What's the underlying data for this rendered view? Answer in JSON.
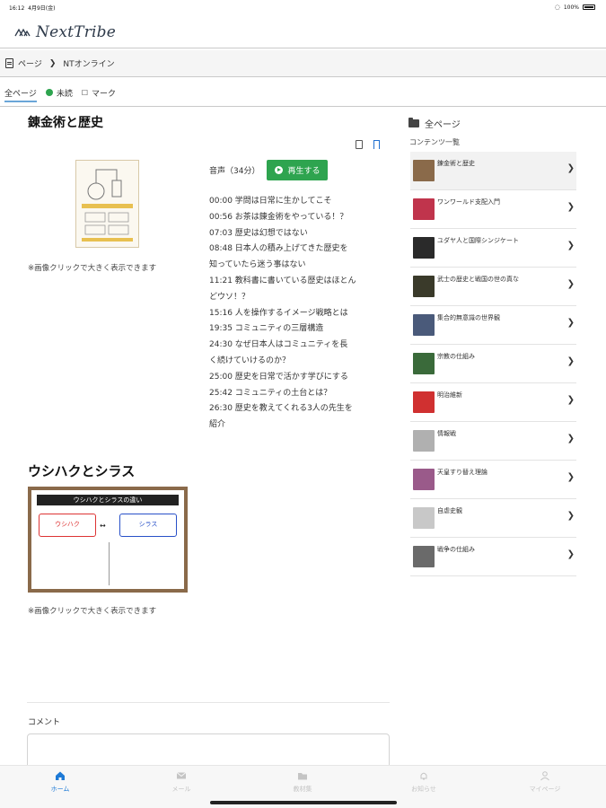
{
  "status_bar": {
    "time": "16:12",
    "date": "4月9日(金)",
    "battery": "100%"
  },
  "app": {
    "name": "NextTribe"
  },
  "breadcrumb": {
    "items": [
      "ページ",
      "NTオンライン"
    ]
  },
  "filters": [
    {
      "label": "全ページ",
      "active": true
    },
    {
      "label": "未読",
      "active": false
    },
    {
      "label": "マーク",
      "active": false
    }
  ],
  "main": {
    "section1": {
      "title": "錬金術と歴史",
      "image_caption": "※画像クリックで大きく表示できます",
      "audio_label": "音声（34分）",
      "play_label": "再生する",
      "chapters": [
        "00:00 学問は日常に生かしてこそ",
        "00:56 お茶は錬金術をやっている！？",
        "07:03 歴史は幻想ではない",
        "08:48 日本人の積み上げてきた歴史を",
        "知っていたら迷う事はない",
        "11:21 教科書に書いている歴史はほとん",
        "どウソ！？",
        "15:16 人を操作するイメージ戦略とは",
        "19:35 コミュニティの三層構造",
        "24:30 なぜ日本人はコミュニティを長",
        "く続けていけるのか？",
        "25:00 歴史を日常で活かす学びにする",
        "25:42 コミュニティの土台とは？",
        "26:30 歴史を教えてくれる3人の先生を",
        "紹介"
      ]
    },
    "section2": {
      "title": "ウシハクとシラス",
      "image_caption": "※画像クリックで大きく表示できます",
      "image_title": "ウシハクとシラスの違い",
      "image_left": "ウシハク",
      "image_right": "シラス"
    },
    "comment_label": "コメント"
  },
  "sidebar": {
    "header": "全ページ",
    "subheader": "コンテンツ一覧",
    "items": [
      {
        "label": "錬金術と歴史",
        "color": "#8a6a4a"
      },
      {
        "label": "ワンワールド支配入門",
        "color": "#c0344c"
      },
      {
        "label": "ユダヤ人と国際シンジケート",
        "color": "#2a2a2a"
      },
      {
        "label": "武士の歴史と戦国の世の真な",
        "color": "#3a3a2a"
      },
      {
        "label": "集合的無意識の世界観",
        "color": "#4a5a7a"
      },
      {
        "label": "宗教の仕組み",
        "color": "#3a6a3a"
      },
      {
        "label": "明治維新",
        "color": "#d03030"
      },
      {
        "label": "情報戦",
        "color": "#b0b0b0"
      },
      {
        "label": "天皇すり替え理論",
        "color": "#9a5a8a"
      },
      {
        "label": "自虐史観",
        "color": "#c8c8c8"
      },
      {
        "label": "戦争の仕組み",
        "color": "#6a6a6a"
      }
    ]
  },
  "bottom_nav": [
    {
      "label": "ホーム",
      "icon": "home-icon",
      "active": true
    },
    {
      "label": "メール",
      "icon": "mail-icon",
      "active": false
    },
    {
      "label": "教材集",
      "icon": "folder-icon",
      "active": false
    },
    {
      "label": "お知らせ",
      "icon": "bell-icon",
      "active": false
    },
    {
      "label": "マイページ",
      "icon": "user-icon",
      "active": false
    }
  ],
  "colors": {
    "accent": "#2ea44f",
    "link": "#1e7ad6",
    "tab_underline": "#6aa6d8"
  }
}
